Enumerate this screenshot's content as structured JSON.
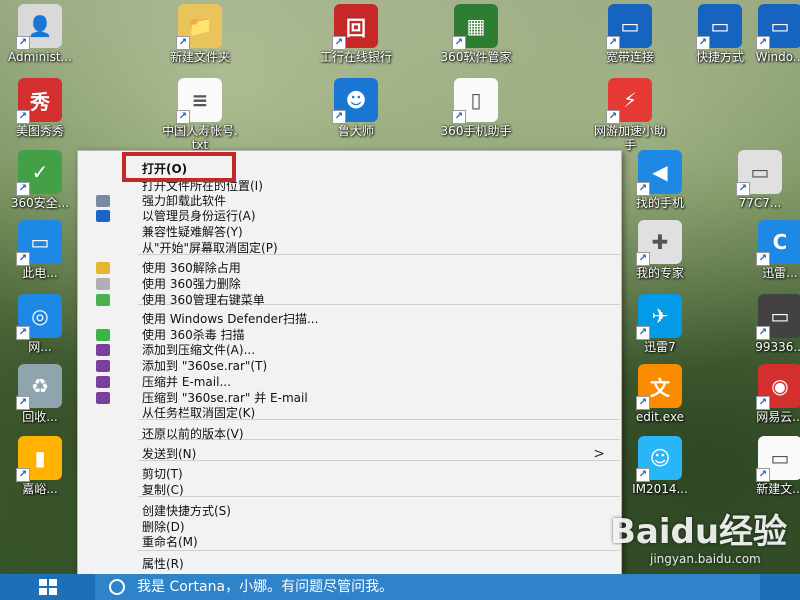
{
  "desktop_icons": [
    {
      "label": "Administ...",
      "glyph": "👤",
      "color": "#d9d9d9"
    },
    {
      "label": "新建文件夹",
      "glyph": "📁",
      "color": "#e8c45a"
    },
    {
      "label": "工行在线银行",
      "glyph": "回",
      "color": "#c62828"
    },
    {
      "label": "360软件管家",
      "glyph": "▦",
      "color": "#2e7d32"
    },
    {
      "label": "宽带连接",
      "glyph": "▭",
      "color": "#1565c0"
    },
    {
      "label": "快捷方式",
      "glyph": "▭",
      "color": "#1565c0"
    },
    {
      "label": "Windo...",
      "glyph": "▭",
      "color": "#1565c0"
    },
    {
      "label": "美图秀秀",
      "glyph": "秀",
      "color": "#d32f2f"
    },
    {
      "label": "中国人寿帐号.txt",
      "glyph": "≡",
      "color": "#fafafa"
    },
    {
      "label": "鲁大师",
      "glyph": "☻",
      "color": "#1976d2"
    },
    {
      "label": "360手机助手",
      "glyph": "▯",
      "color": "#fafafa"
    },
    {
      "label": "网游加速小助手",
      "glyph": "⚡",
      "color": "#e53935"
    },
    {
      "label": "360安全...",
      "glyph": "✓",
      "color": "#43a047"
    },
    {
      "label": "找的手机",
      "glyph": "◀",
      "color": "#1e88e5"
    },
    {
      "label": "77C7...",
      "glyph": "▭",
      "color": "#e0e0e0"
    },
    {
      "label": "此电...",
      "glyph": "▭",
      "color": "#1e88e5"
    },
    {
      "label": "我的专家",
      "glyph": "✚",
      "color": "#e0e0e0"
    },
    {
      "label": "迅雷...",
      "glyph": "C",
      "color": "#1e88e5"
    },
    {
      "label": "网...",
      "glyph": "◎",
      "color": "#1e88e5"
    },
    {
      "label": "迅雷7",
      "glyph": "✈",
      "color": "#039be5"
    },
    {
      "label": "99336...",
      "glyph": "▭",
      "color": "#424242"
    },
    {
      "label": "回收...",
      "glyph": "♻",
      "color": "#90a4ae"
    },
    {
      "label": "edit.exe",
      "glyph": "文",
      "color": "#fb8c00"
    },
    {
      "label": "网易云...",
      "glyph": "◉",
      "color": "#d32f2f"
    },
    {
      "label": "嘉峪...",
      "glyph": "▮",
      "color": "#ffb300"
    },
    {
      "label": "IM2014...",
      "glyph": "☺",
      "color": "#29b6f6"
    },
    {
      "label": "新建文...",
      "glyph": "▭",
      "color": "#fafafa"
    }
  ],
  "context_menu": {
    "items": [
      {
        "label": "打开(O)",
        "bold": true,
        "icon": ""
      },
      {
        "label": "打开文件所在的位置(I)",
        "icon": ""
      },
      {
        "label": "强力卸载此软件",
        "icon": "uninstall-icon",
        "icon_color": "#7a8aa0"
      },
      {
        "label": "以管理员身份运行(A)",
        "icon": "shield-icon",
        "icon_color": "#1e63c8"
      },
      {
        "label": "兼容性疑难解答(Y)",
        "icon": ""
      },
      {
        "label": "从\"开始\"屏幕取消固定(P)",
        "icon": ""
      },
      {
        "label": "使用 360解除占用",
        "icon": "unlock-360-icon",
        "icon_color": "#e5b730",
        "sep_before": true
      },
      {
        "label": "使用 360强力删除",
        "icon": "delete-360-icon",
        "icon_color": "#b0b0b0"
      },
      {
        "label": "使用 360管理右键菜单",
        "icon": "menu-360-icon",
        "icon_color": "#4caf50"
      },
      {
        "label": "使用 Windows Defender扫描...",
        "icon": "",
        "sep_before": true
      },
      {
        "label": "使用 360杀毒 扫描",
        "icon": "antivirus-360-icon",
        "icon_color": "#3bb54a"
      },
      {
        "label": "添加到压缩文件(A)...",
        "icon": "winrar-icon",
        "icon_color": "#7b3fa0"
      },
      {
        "label": "添加到 \"360se.rar\"(T)",
        "icon": "winrar-icon",
        "icon_color": "#7b3fa0"
      },
      {
        "label": "压缩并 E-mail...",
        "icon": "winrar-icon",
        "icon_color": "#7b3fa0"
      },
      {
        "label": "压缩到 \"360se.rar\" 并 E-mail",
        "icon": "winrar-icon",
        "icon_color": "#7b3fa0"
      },
      {
        "label": "从任务栏取消固定(K)",
        "icon": ""
      },
      {
        "label": "还原以前的版本(V)",
        "icon": "",
        "sep_before": true
      },
      {
        "label": "发送到(N)",
        "icon": "",
        "submenu": true,
        "sep_before": true
      },
      {
        "label": "剪切(T)",
        "icon": "",
        "sep_before": true
      },
      {
        "label": "复制(C)",
        "icon": ""
      },
      {
        "label": "创建快捷方式(S)",
        "icon": "",
        "sep_before": true
      },
      {
        "label": "删除(D)",
        "icon": ""
      },
      {
        "label": "重命名(M)",
        "icon": ""
      },
      {
        "label": "属性(R)",
        "icon": "",
        "sep_before": true
      }
    ],
    "submenu_arrow": ">"
  },
  "taskbar": {
    "start_icon": "windows-logo-icon",
    "search_text": "我是 Cortana，小娜。有问题尽管问我。"
  },
  "watermark": {
    "logo": "Baidu经验",
    "url": "jingyan.baidu.com"
  }
}
